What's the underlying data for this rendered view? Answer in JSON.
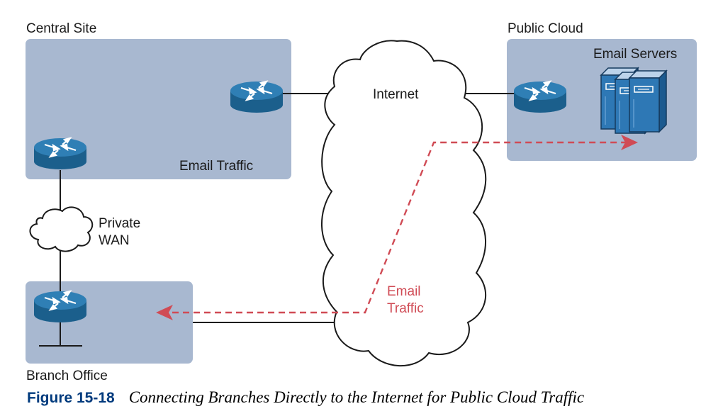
{
  "diagram": {
    "sites": {
      "central": {
        "label": "Central Site",
        "traffic_label": "Email Traffic"
      },
      "cloud": {
        "label": "Public Cloud",
        "servers_label": "Email Servers"
      },
      "branch": {
        "label": "Branch Office"
      }
    },
    "clouds": {
      "internet": {
        "label": "Internet"
      },
      "wan": {
        "label_line1": "Private",
        "label_line2": "WAN"
      }
    },
    "flow": {
      "label_line1": "Email",
      "label_line2": "Traffic",
      "color": "#d04b55"
    },
    "colors": {
      "site_fill": "#a8b8d0",
      "router": "#1f6fa3",
      "server": "#2e78b5"
    }
  },
  "caption": {
    "number": "Figure 15-18",
    "title": "Connecting Branches Directly to the Internet for Public Cloud Traffic"
  }
}
